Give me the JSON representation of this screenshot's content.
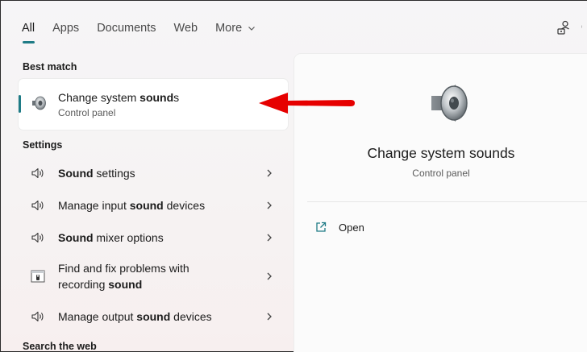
{
  "tabs": [
    {
      "label": "All"
    },
    {
      "label": "Apps"
    },
    {
      "label": "Documents"
    },
    {
      "label": "Web"
    },
    {
      "label": "More"
    }
  ],
  "sections": {
    "best_match": "Best match",
    "settings": "Settings",
    "search_web": "Search the web"
  },
  "best_match": {
    "title_prefix": "Change system ",
    "title_bold": "sound",
    "title_suffix": "s",
    "subtitle": "Control panel",
    "icon": "speaker-icon"
  },
  "settings_items": [
    {
      "parts": [
        {
          "t": "Sound",
          "b": true
        },
        {
          "t": " settings",
          "b": false
        }
      ],
      "icon": "speaker-volume-icon"
    },
    {
      "parts": [
        {
          "t": "Manage input ",
          "b": false
        },
        {
          "t": "sound",
          "b": true
        },
        {
          "t": " devices",
          "b": false
        }
      ],
      "icon": "speaker-volume-icon"
    },
    {
      "parts": [
        {
          "t": "Sound",
          "b": true
        },
        {
          "t": " mixer options",
          "b": false
        }
      ],
      "icon": "speaker-volume-icon"
    },
    {
      "line1": "Find and fix problems with",
      "line2_prefix": "recording ",
      "line2_bold": "sound",
      "icon": "troubleshoot-icon"
    },
    {
      "parts": [
        {
          "t": "Manage output ",
          "b": false
        },
        {
          "t": "sound",
          "b": true
        },
        {
          "t": " devices",
          "b": false
        }
      ],
      "icon": "speaker-volume-icon"
    }
  ],
  "detail": {
    "title": "Change system sounds",
    "subtitle": "Control panel",
    "open_label": "Open"
  },
  "colors": {
    "accent": "#1f7b86",
    "annotation_arrow": "#e60000"
  }
}
